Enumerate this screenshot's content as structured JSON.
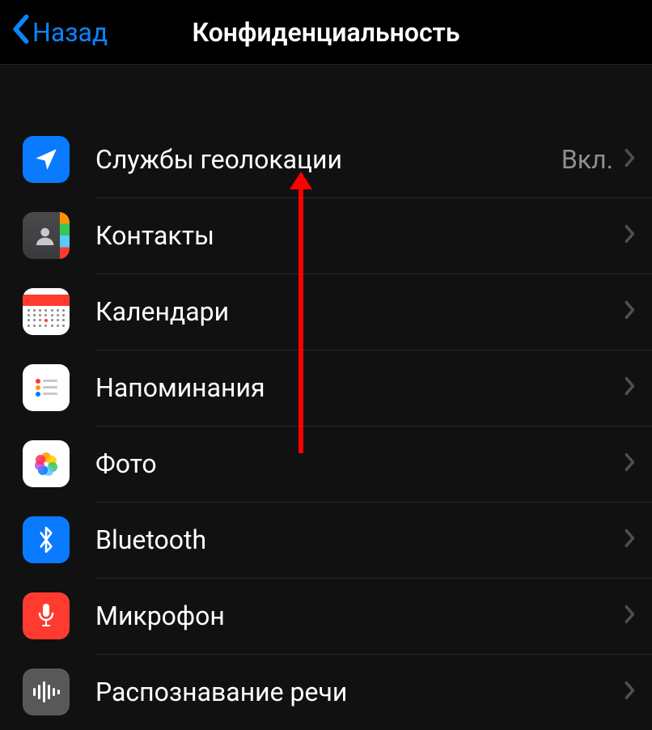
{
  "header": {
    "back_label": "Назад",
    "title": "Конфиденциальность"
  },
  "rows": [
    {
      "label": "Службы геолокации",
      "value": "Вкл."
    },
    {
      "label": "Контакты",
      "value": ""
    },
    {
      "label": "Календари",
      "value": ""
    },
    {
      "label": "Напоминания",
      "value": ""
    },
    {
      "label": "Фото",
      "value": ""
    },
    {
      "label": "Bluetooth",
      "value": ""
    },
    {
      "label": "Микрофон",
      "value": ""
    },
    {
      "label": "Распознавание речи",
      "value": ""
    }
  ]
}
